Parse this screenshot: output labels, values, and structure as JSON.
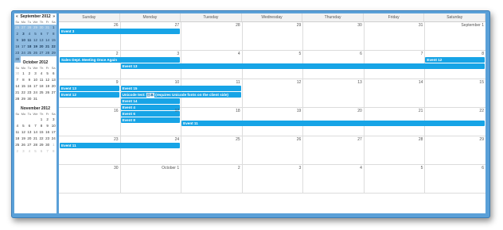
{
  "navigator": {
    "months": [
      {
        "title": "September 2012",
        "prev_icon": "«",
        "next_icon": "»",
        "dow": [
          "Su",
          "Mo",
          "Tu",
          "We",
          "Th",
          "Fr",
          "Sa"
        ],
        "weeks": [
          [
            "26",
            "27",
            "28",
            "29",
            "30",
            "31",
            "1"
          ],
          [
            "2",
            "3",
            "4",
            "5",
            "6",
            "7",
            "8"
          ],
          [
            "9",
            "10",
            "11",
            "12",
            "13",
            "14",
            "15"
          ],
          [
            "16",
            "17",
            "18",
            "19",
            "20",
            "21",
            "22"
          ],
          [
            "23",
            "24",
            "25",
            "26",
            "27",
            "28",
            "29"
          ],
          [
            "30",
            "",
            "",
            "",
            "",
            "",
            ""
          ]
        ]
      },
      {
        "title": "October 2012",
        "dow": [
          "Su",
          "Mo",
          "Tu",
          "We",
          "Th",
          "Fr",
          "Sa"
        ],
        "weeks": [
          [
            "30",
            "1",
            "2",
            "3",
            "4",
            "5",
            "6"
          ],
          [
            "7",
            "8",
            "9",
            "10",
            "11",
            "12",
            "13"
          ],
          [
            "14",
            "15",
            "16",
            "17",
            "18",
            "19",
            "20"
          ],
          [
            "21",
            "22",
            "23",
            "24",
            "25",
            "26",
            "27"
          ],
          [
            "28",
            "29",
            "30",
            "31",
            "",
            "",
            ""
          ]
        ]
      },
      {
        "title": "November 2012",
        "dow": [
          "Su",
          "Mo",
          "Tu",
          "We",
          "Th",
          "Fr",
          "Sa"
        ],
        "weeks": [
          [
            "",
            "",
            "",
            "",
            "1",
            "2",
            "3"
          ],
          [
            "4",
            "5",
            "6",
            "7",
            "8",
            "9",
            "10"
          ],
          [
            "11",
            "12",
            "13",
            "14",
            "15",
            "16",
            "17"
          ],
          [
            "18",
            "19",
            "20",
            "21",
            "22",
            "23",
            "24"
          ],
          [
            "25",
            "26",
            "27",
            "28",
            "29",
            "30",
            "1"
          ],
          [
            "2",
            "3",
            "4",
            "5",
            "6",
            "7",
            "8"
          ]
        ]
      }
    ]
  },
  "calendar": {
    "dow": [
      "Sunday",
      "Monday",
      "Tuesday",
      "Wednesday",
      "Thursday",
      "Friday",
      "Saturday"
    ],
    "weeks": [
      [
        "26",
        "27",
        "28",
        "29",
        "30",
        "31",
        "September 1"
      ],
      [
        "2",
        "3",
        "4",
        "5",
        "6",
        "7",
        "8"
      ],
      [
        "9",
        "10",
        "11",
        "12",
        "13",
        "14",
        "15"
      ],
      [
        "16",
        "17",
        "18",
        "19",
        "20",
        "21",
        "22"
      ],
      [
        "23",
        "24",
        "25",
        "26",
        "27",
        "28",
        "29"
      ],
      [
        "30",
        "October 1",
        "2",
        "3",
        "4",
        "5",
        "6"
      ]
    ],
    "events": [
      {
        "text": "Event 3",
        "week": 0,
        "start": 0,
        "span": 2,
        "row": 0
      },
      {
        "text": "Sales Dept. Meeting Once Again",
        "week": 1,
        "start": 0,
        "span": 2,
        "row": 0
      },
      {
        "text": "Event 12",
        "week": 1,
        "start": 6,
        "span": 1,
        "row": 0
      },
      {
        "text": "Event 13",
        "week": 1,
        "start": 1,
        "span": 6,
        "row": 1
      },
      {
        "text": "Event 13",
        "week": 2,
        "start": 0,
        "span": 1,
        "row": 0
      },
      {
        "text": "Event 12",
        "week": 2,
        "start": 0,
        "span": 1,
        "row": 1
      },
      {
        "text": "Event 15",
        "week": 2,
        "start": 1,
        "span": 2,
        "row": 0
      },
      {
        "text": "Unicode test:",
        "unicode": "日本",
        "suffix": "(requires Unicode fonts on the client side)",
        "week": 2,
        "start": 1,
        "span": 2,
        "row": 1
      },
      {
        "text": "Event 14",
        "week": 2,
        "start": 1,
        "span": 1,
        "row": 2
      },
      {
        "text": "Event 4",
        "week": 2,
        "start": 1,
        "span": 1,
        "row": 3
      },
      {
        "text": "Event 6",
        "week": 2,
        "start": 1,
        "span": 1,
        "row": 4
      },
      {
        "text": "Event 8",
        "week": 2,
        "start": 1,
        "span": 1,
        "row": 5
      },
      {
        "text": "Event 11",
        "week": 3,
        "start": 2,
        "span": 5,
        "row": 1
      },
      {
        "text": "Event 11",
        "week": 4,
        "start": 0,
        "span": 2,
        "row": 0
      }
    ]
  },
  "colors": {
    "event": "#17a4e6",
    "frame": "#5aa0d8",
    "selected": "#8fbbe0"
  }
}
